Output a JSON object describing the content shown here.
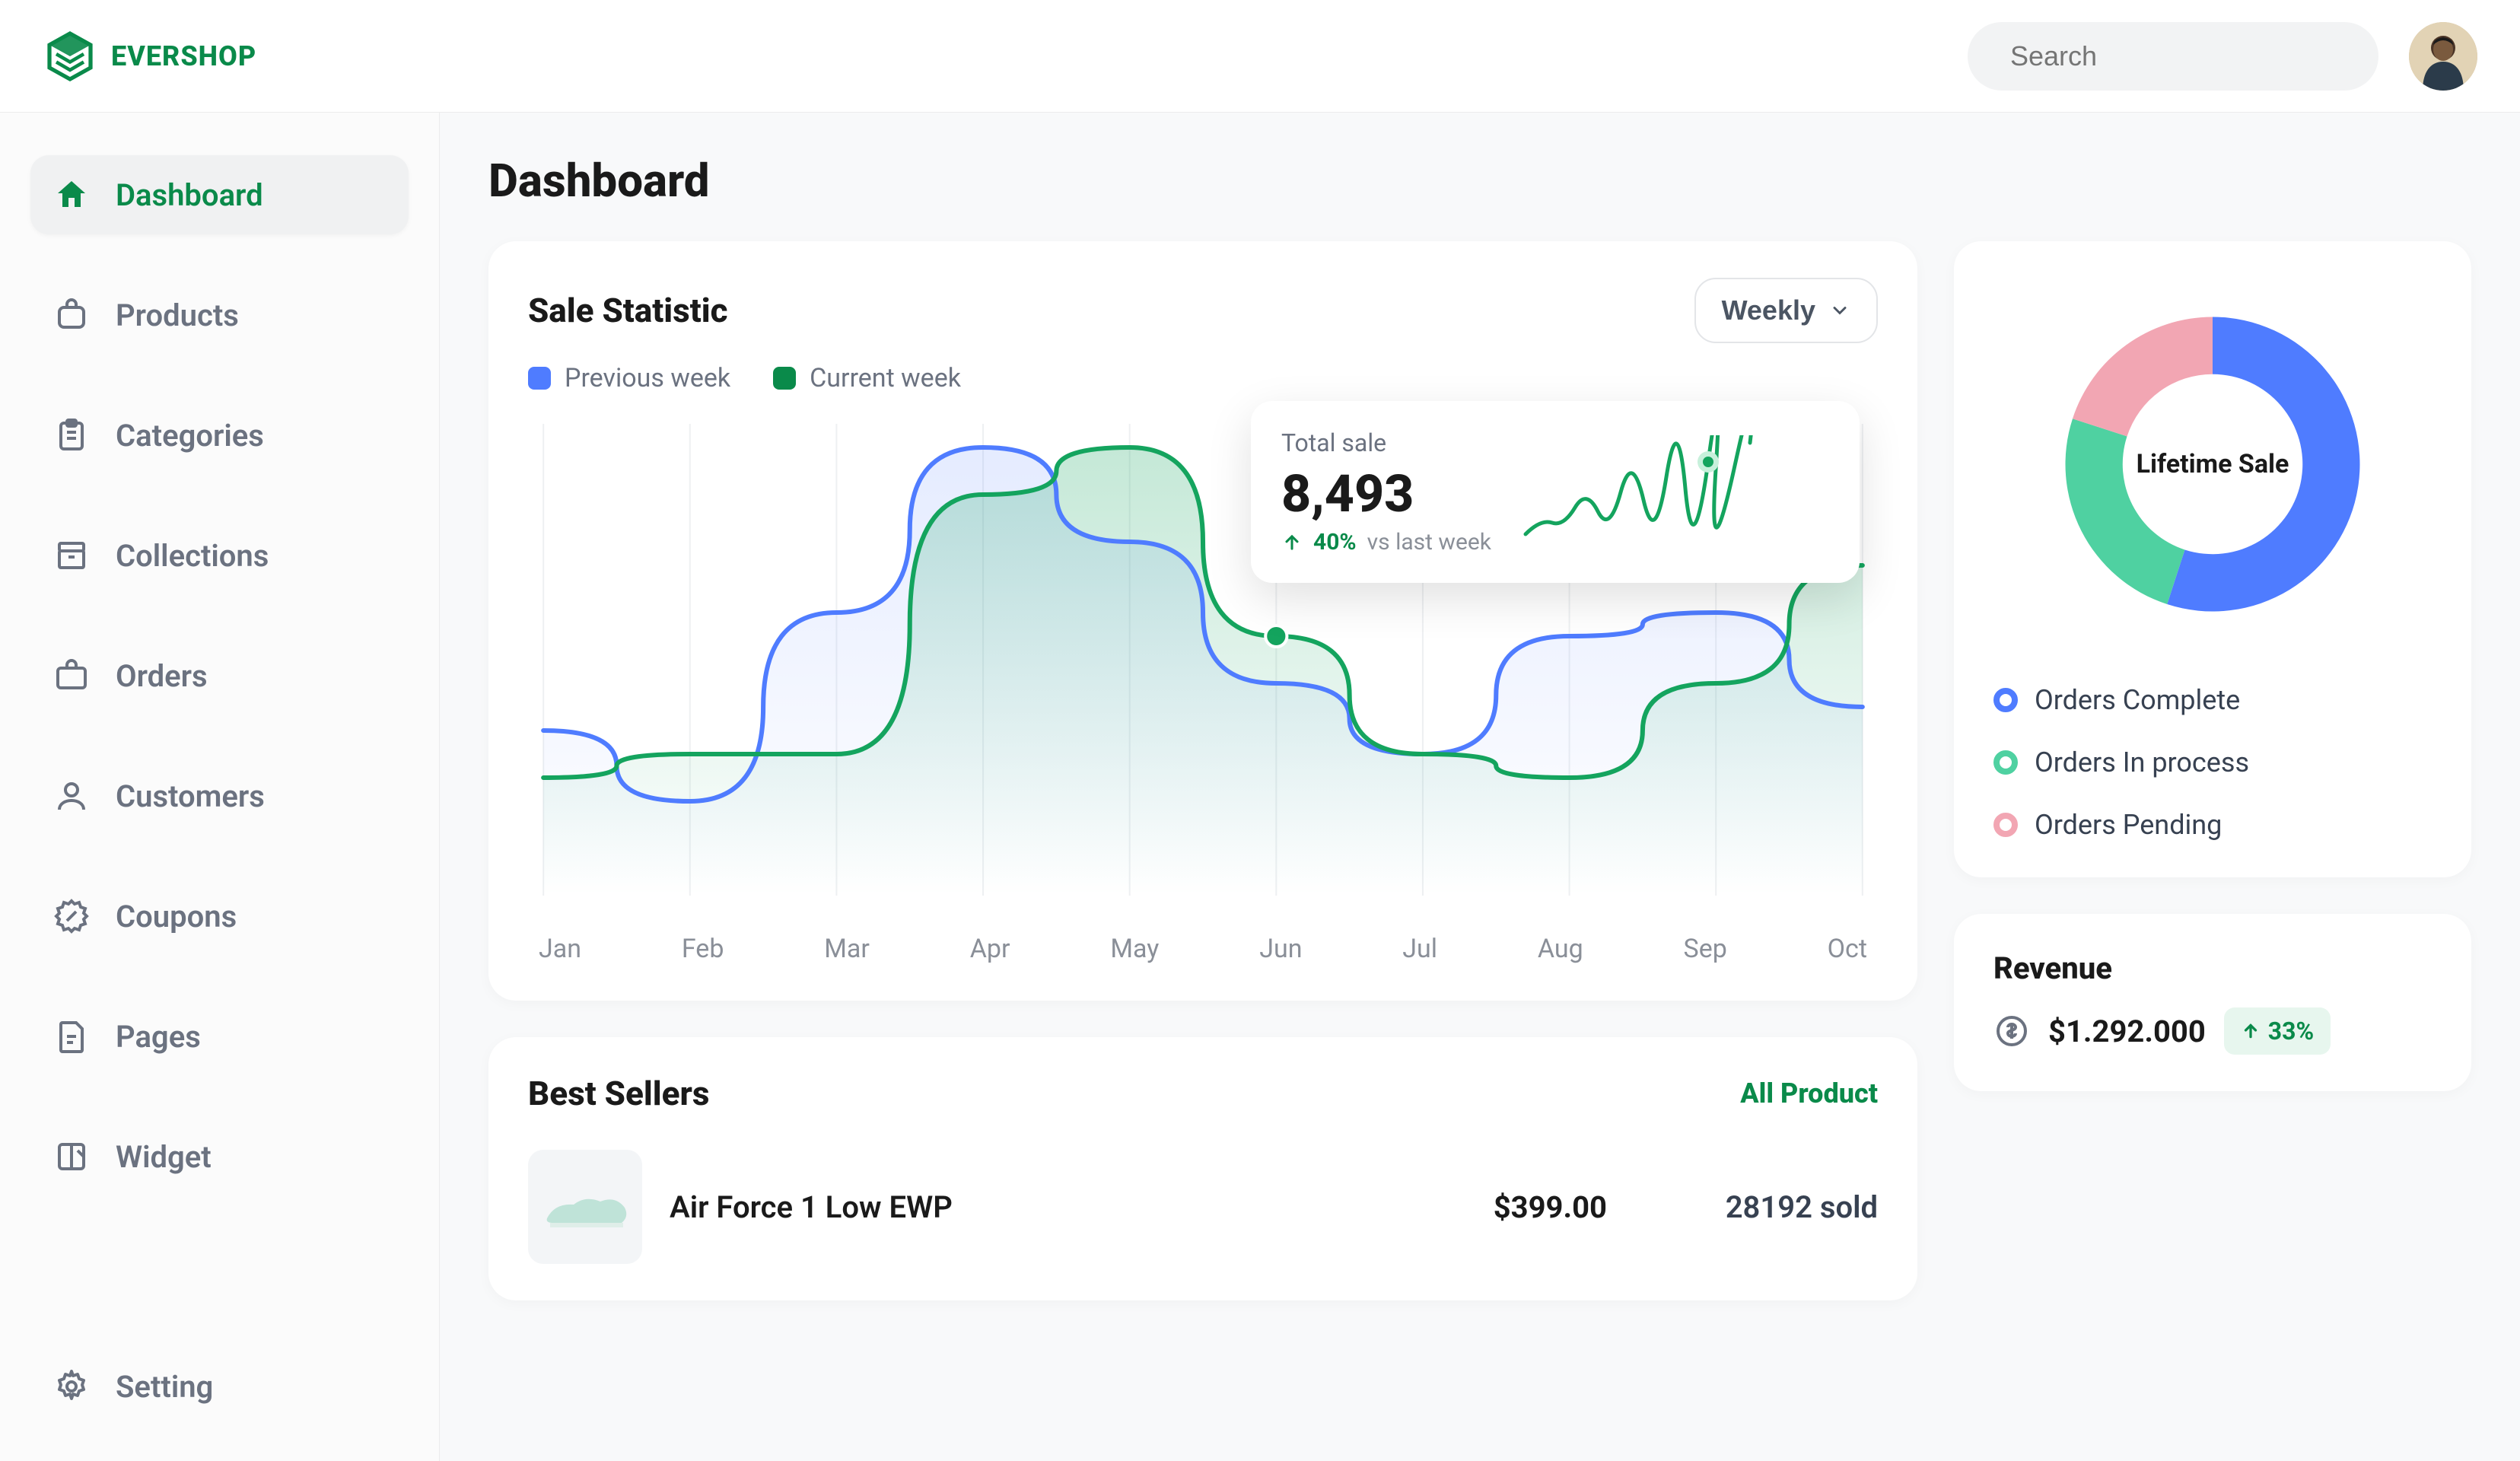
{
  "brand": {
    "name": "EVERSHOP"
  },
  "search": {
    "placeholder": "Search"
  },
  "sidebar": {
    "items": [
      {
        "label": "Dashboard"
      },
      {
        "label": "Products"
      },
      {
        "label": "Categories"
      },
      {
        "label": "Collections"
      },
      {
        "label": "Orders"
      },
      {
        "label": "Customers"
      },
      {
        "label": "Coupons"
      },
      {
        "label": "Pages"
      },
      {
        "label": "Widget"
      }
    ],
    "footer": {
      "label": "Setting"
    }
  },
  "page": {
    "title": "Dashboard"
  },
  "sale": {
    "title": "Sale Statistic",
    "period_label": "Weekly",
    "legend": {
      "prev": "Previous week",
      "curr": "Current week"
    },
    "tooltip": {
      "label": "Total sale",
      "value": "8,493",
      "delta_pct": "40%",
      "delta_text": "vs last week"
    }
  },
  "colors": {
    "green": "#0a8a4a",
    "green_fill": "#14a45e",
    "blue": "#4f7cff",
    "teal": "#4fd1a1",
    "pink": "#f2a6b3",
    "gray": "#8a8f98"
  },
  "chart_data": [
    {
      "type": "line",
      "title": "Sale Statistic",
      "categories": [
        "Jan",
        "Feb",
        "Mar",
        "Apr",
        "May",
        "Jun",
        "Jul",
        "Aug",
        "Sep",
        "Oct"
      ],
      "ylim": [
        0,
        100
      ],
      "series": [
        {
          "name": "Previous week",
          "color": "#4f7cff",
          "values": [
            35,
            20,
            60,
            95,
            75,
            45,
            30,
            55,
            60,
            40
          ]
        },
        {
          "name": "Current week",
          "color": "#14a45e",
          "values": [
            25,
            30,
            30,
            85,
            95,
            55,
            30,
            25,
            45,
            70
          ]
        }
      ]
    },
    {
      "type": "pie",
      "title": "Lifetime Sale",
      "series": [
        {
          "name": "Orders Complete",
          "color": "#4f7cff",
          "value": 55
        },
        {
          "name": "Orders In process",
          "color": "#4fd1a1",
          "value": 25
        },
        {
          "name": "Orders Pending",
          "color": "#f2a6b3",
          "value": 20
        }
      ]
    }
  ],
  "donut": {
    "center_label": "Lifetime Sale",
    "legend": [
      {
        "label": "Orders Complete",
        "color": "#4f7cff"
      },
      {
        "label": "Orders In process",
        "color": "#4fd1a1"
      },
      {
        "label": "Orders Pending",
        "color": "#f2a6b3"
      }
    ]
  },
  "revenue": {
    "title": "Revenue",
    "value": "$1.292.000",
    "delta": "33%"
  },
  "sellers": {
    "title": "Best Sellers",
    "link": "All Product",
    "items": [
      {
        "name": "Air Force 1 Low EWP",
        "price": "$399.00",
        "sold": "28192 sold"
      }
    ]
  }
}
